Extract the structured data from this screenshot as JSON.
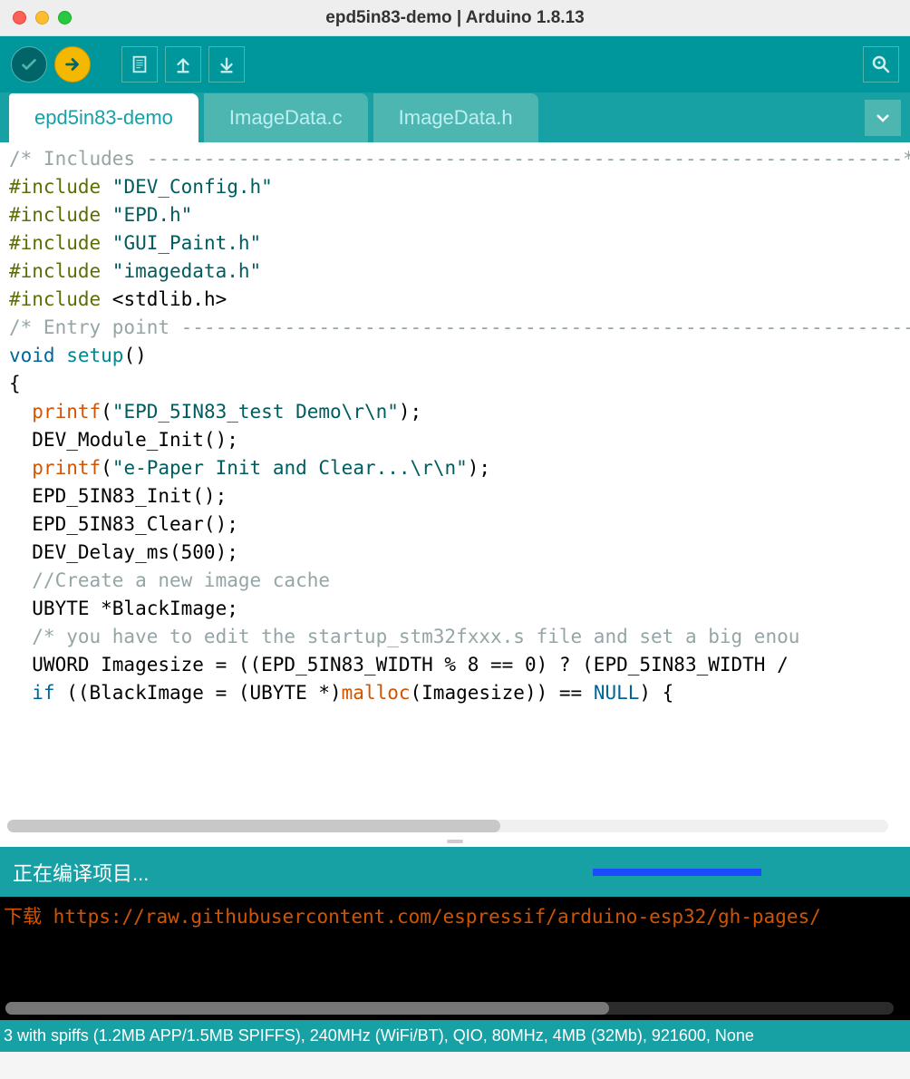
{
  "window": {
    "title": "epd5in83-demo | Arduino 1.8.13"
  },
  "toolbar": {
    "verify": "verify",
    "upload": "upload",
    "new": "new",
    "open": "open",
    "save": "save",
    "serial": "serial-monitor"
  },
  "tabs": [
    {
      "label": "epd5in83-demo",
      "active": true
    },
    {
      "label": "ImageData.c",
      "active": false
    },
    {
      "label": "ImageData.h",
      "active": false
    }
  ],
  "code": {
    "l1a": "/* Includes ",
    "l1b": "------------------------------------------------------------------*/",
    "l2a": "#include",
    "l2b": " \"DEV_Config.h\"",
    "l3a": "#include",
    "l3b": " \"EPD.h\"",
    "l4a": "#include",
    "l4b": " \"GUI_Paint.h\"",
    "l5a": "#include",
    "l5b": " \"imagedata.h\"",
    "l6a": "#include",
    "l6b": " <stdlib.h>",
    "l7": "",
    "l8a": "/* Entry point ",
    "l8b": "----------------------------------------------------------------*/",
    "l9a": "void",
    "l9b": " setup",
    "l9c": "()",
    "l10": "{",
    "l11a": "  printf",
    "l11b": "(",
    "l11c": "\"EPD_5IN83_test Demo\\r\\n\"",
    "l11d": ");",
    "l12": "  DEV_Module_Init();",
    "l13": "",
    "l14a": "  printf",
    "l14b": "(",
    "l14c": "\"e-Paper Init and Clear...\\r\\n\"",
    "l14d": ");",
    "l15": "  EPD_5IN83_Init();",
    "l16": "  EPD_5IN83_Clear();",
    "l17": "  DEV_Delay_ms(500);",
    "l18": "",
    "l19": "  //Create a new image cache",
    "l20": "  UBYTE *BlackImage;",
    "l21": "  /* you have to edit the startup_stm32fxxx.s file and set a big enou",
    "l22": "  UWORD Imagesize = ((EPD_5IN83_WIDTH % 8 == 0) ? (EPD_5IN83_WIDTH / ",
    "l23a": "  if",
    "l23b": " ((BlackImage = (UBYTE *)",
    "l23c": "malloc",
    "l23d": "(Imagesize)) == ",
    "l23e": "NULL",
    "l23f": ") {"
  },
  "status": {
    "compiling": "正在编译项目..."
  },
  "console": {
    "line1a": "下载 ",
    "line1b": "https://raw.githubusercontent.com/espressif/arduino-esp32/gh-pages/"
  },
  "bottom": {
    "text": "3 with spiffs (1.2MB APP/1.5MB SPIFFS), 240MHz (WiFi/BT), QIO, 80MHz, 4MB (32Mb), 921600, None"
  }
}
